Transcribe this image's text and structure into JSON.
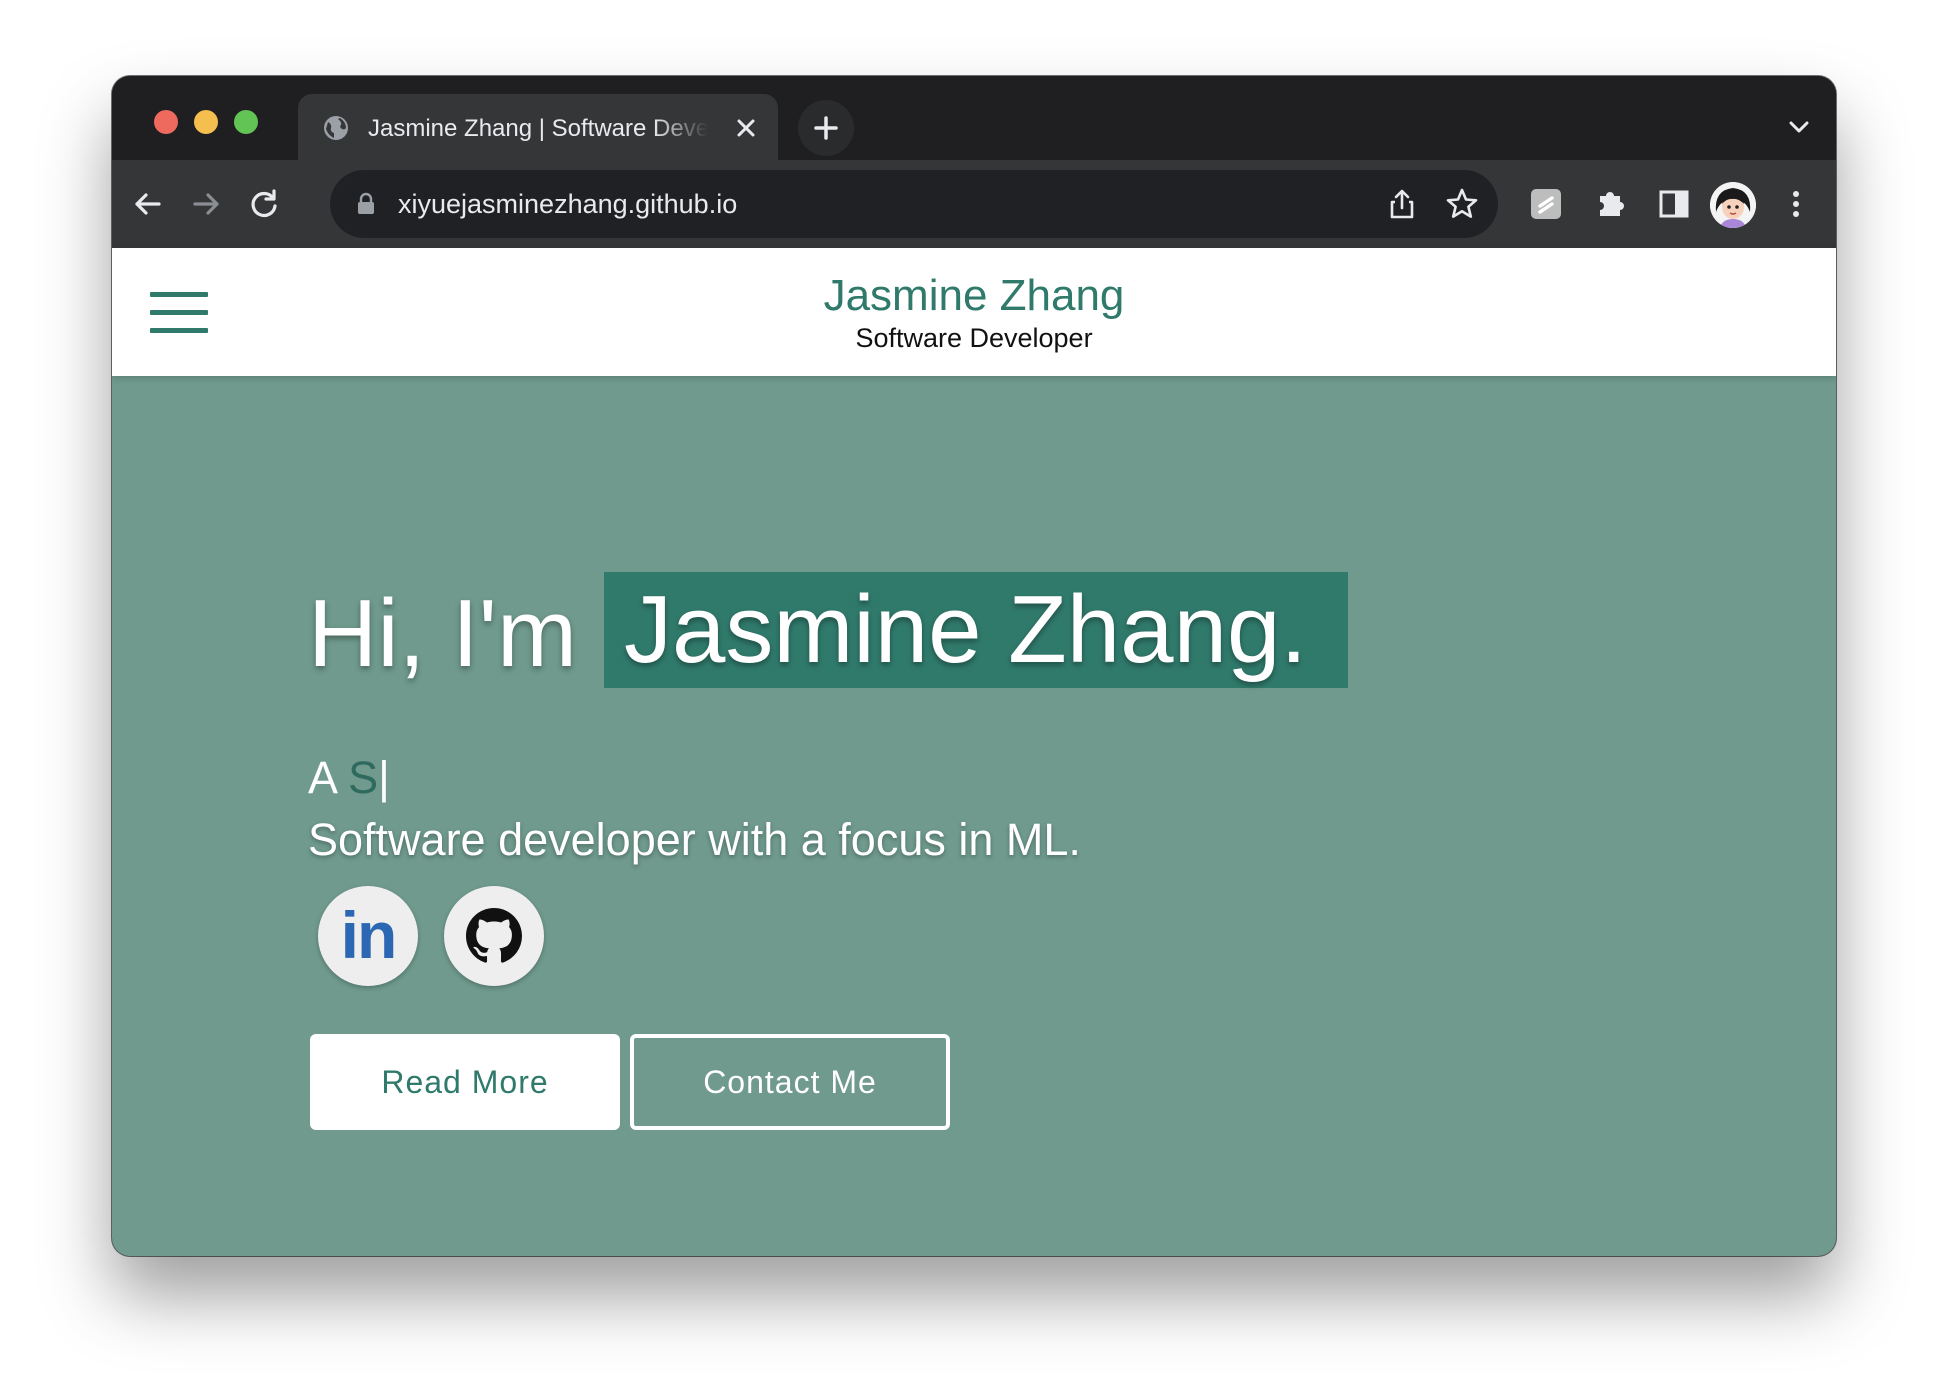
{
  "browser": {
    "tab": {
      "title": "Jasmine Zhang | Software Developer"
    },
    "address_bar": {
      "url": "xiyuejasminezhang.github.io"
    },
    "icons": {
      "back": "back-arrow-icon",
      "forward": "forward-arrow-icon",
      "reload": "reload-icon",
      "lock": "lock-icon",
      "share": "share-icon",
      "bookmark": "star-icon",
      "extension_1": "extension-icon",
      "extensions": "puzzle-icon",
      "side_panel": "side-panel-icon",
      "profile": "avatar",
      "menu": "kebab-menu-icon"
    }
  },
  "site": {
    "header": {
      "name": "Jasmine Zhang",
      "role": "Software Developer"
    },
    "hero": {
      "greeting": "Hi, I'm",
      "name": "Jasmine Zhang.",
      "typed_prefix": "A",
      "typed_text": "S",
      "cursor": "|",
      "tagline": "Software developer with a focus in ML."
    },
    "social": {
      "linkedin_label": "in",
      "github_icon": "github-icon"
    },
    "buttons": {
      "read_more": "Read More",
      "contact": "Contact Me"
    }
  },
  "colors": {
    "accent": "#2f7a6b",
    "hero_background": "#6f9a8d",
    "name_highlight": "#307a6c",
    "linkedin_blue": "#2c67b3"
  }
}
